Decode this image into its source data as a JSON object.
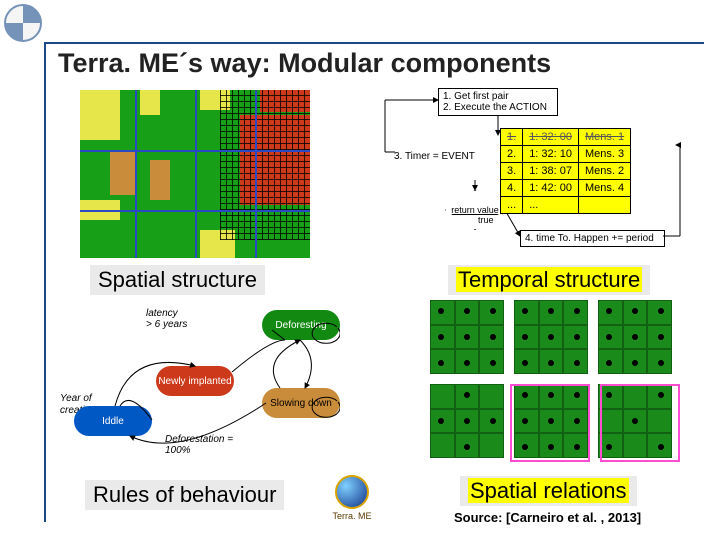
{
  "title": "Terra. ME´s way: Modular components",
  "flow": {
    "step1": "1. Get first pair",
    "step2": "2. Execute the ACTION",
    "timer": "3. Timer = EVENT",
    "return": "return value",
    "true": "true",
    "step4": "4. time To. Happen += period"
  },
  "schedule": [
    {
      "n": "1.",
      "t": "1: 32: 00",
      "m": "Mens. 1"
    },
    {
      "n": "2.",
      "t": "1: 32: 10",
      "m": "Mens. 3"
    },
    {
      "n": "3.",
      "t": "1: 38: 07",
      "m": "Mens. 2"
    },
    {
      "n": "4.",
      "t": "1: 42: 00",
      "m": "Mens. 4"
    },
    {
      "n": "...",
      "t": "...",
      "m": ""
    }
  ],
  "labels": {
    "spatial_structure": "Spatial structure",
    "temporal_structure": "Temporal structure",
    "rules": "Rules of behaviour",
    "relations": "Spatial relations"
  },
  "rules": {
    "idle": "Iddle",
    "newly": "Newly implanted",
    "deforesting": "Deforesting",
    "slowing": "Slowing down",
    "latency1": "latency",
    "latency2": "> 6 years",
    "year1": "Year of",
    "year2": "creation",
    "def1": "Deforestation =",
    "def2": "100%"
  },
  "logo_text": "Terra. ME",
  "source": "Source: [Carneiro et al. , 2013]"
}
